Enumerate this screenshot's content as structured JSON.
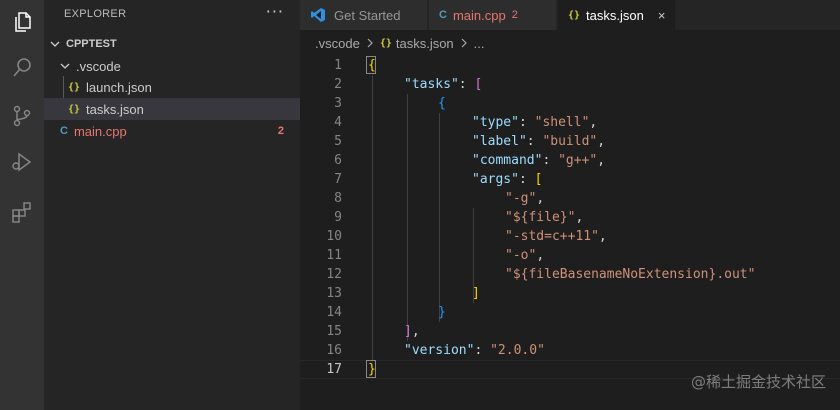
{
  "sidebar": {
    "title": "EXPLORER",
    "more": "···",
    "project": "CPPTEST",
    "folder": ".vscode",
    "files": [
      {
        "name": "launch.json",
        "icon": "{}"
      },
      {
        "name": "tasks.json",
        "icon": "{}"
      }
    ],
    "main_file": {
      "name": "main.cpp",
      "icon": "C",
      "problems": "2"
    }
  },
  "tabs": [
    {
      "label": "Get Started"
    },
    {
      "label": "main.cpp",
      "problems": "2",
      "icon": "C"
    },
    {
      "label": "tasks.json",
      "icon": "{}",
      "close": "×"
    }
  ],
  "breadcrumb": {
    "folder": ".vscode",
    "file": "tasks.json",
    "tail": "..."
  },
  "editor": {
    "line_numbers": [
      "1",
      "2",
      "3",
      "4",
      "5",
      "6",
      "7",
      "8",
      "9",
      "10",
      "11",
      "12",
      "13",
      "14",
      "15",
      "16",
      "17"
    ],
    "current_line": "17",
    "code": {
      "l1_open": "{",
      "l2_key": "\"tasks\"",
      "l2_colon": ": ",
      "l2_bracket": "[",
      "l3_brace": "{",
      "l4_key": "\"type\"",
      "l4_val": "\"shell\"",
      "l5_key": "\"label\"",
      "l5_val": "\"build\"",
      "l6_key": "\"command\"",
      "l6_val": "\"g++\"",
      "l7_key": "\"args\"",
      "l7_bracket": "[",
      "l8_val": "\"-g\"",
      "l9_val": "\"${file}\"",
      "l10_val": "\"-std=c++11\"",
      "l11_val": "\"-o\"",
      "l12_val": "\"${fileBasenameNoExtension}.out\"",
      "l13_bracket": "]",
      "l14_brace": "}",
      "l15_bracket": "]",
      "l16_key": "\"version\"",
      "l16_val": "\"2.0.0\"",
      "l17_close": "}",
      "comma": ",",
      "colon": ": "
    }
  },
  "watermark": "@稀土掘金技术社区",
  "colors": {
    "key": "#9cdcfe",
    "string": "#ce9178",
    "bracket_gold": "#ffd700",
    "bracket_purple": "#da70d6",
    "bracket_blue": "#179fff",
    "error": "#e67670"
  }
}
